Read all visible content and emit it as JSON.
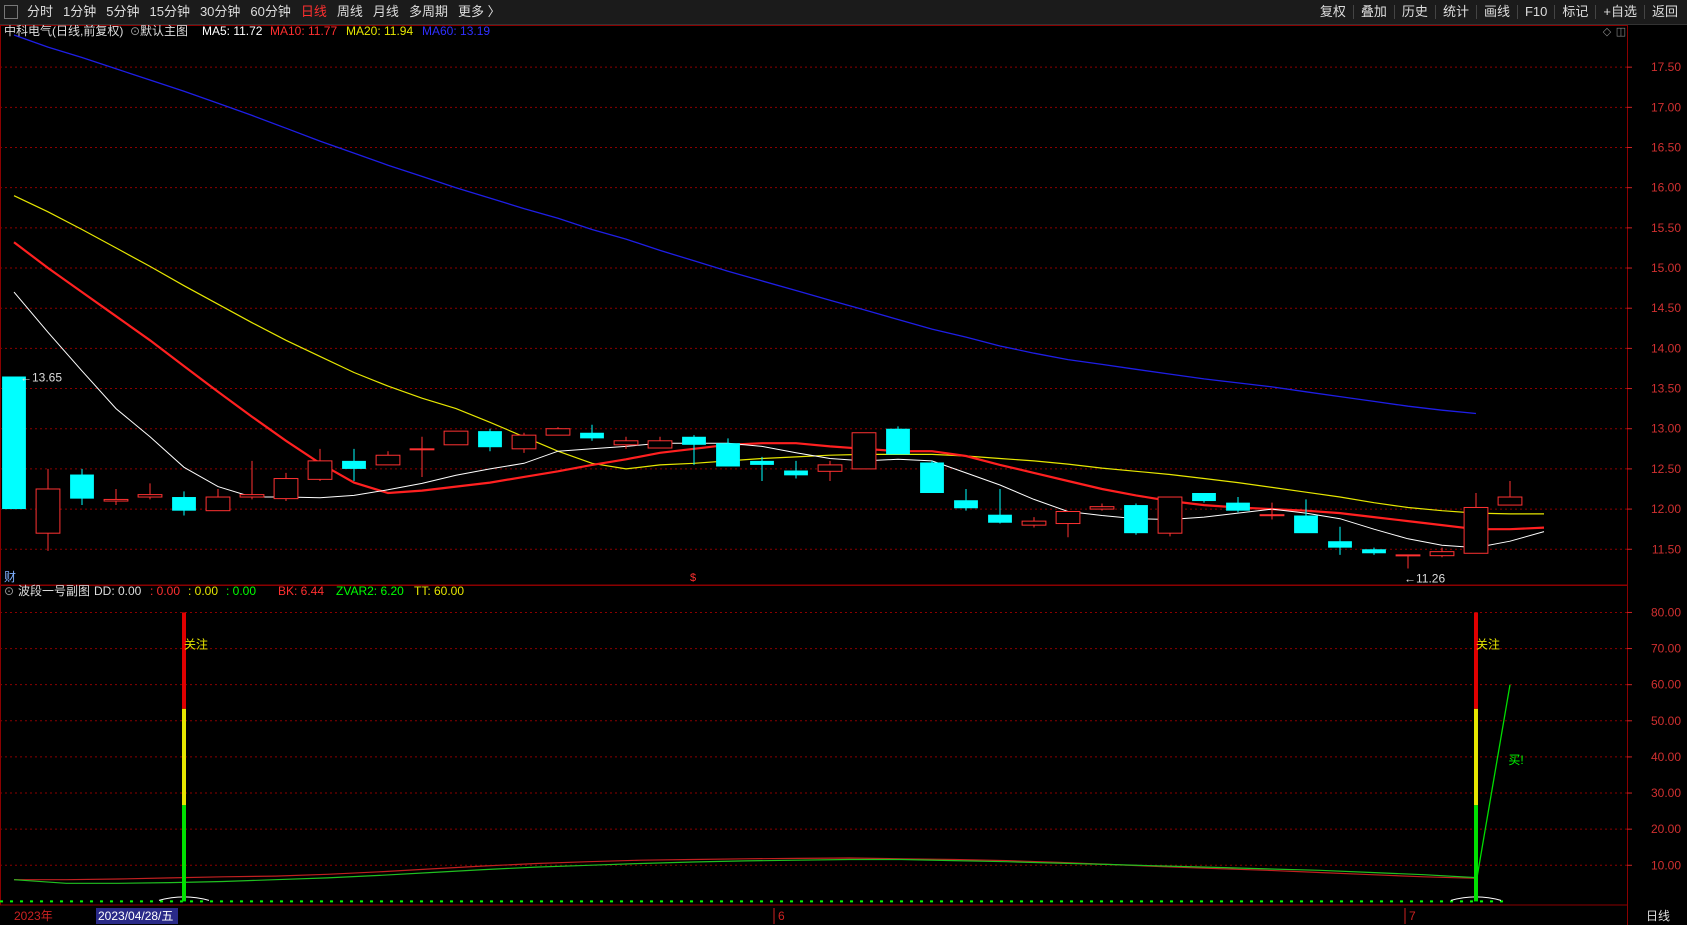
{
  "toolbar": {
    "periods": [
      "分时",
      "1分钟",
      "5分钟",
      "15分钟",
      "30分钟",
      "60分钟",
      "日线",
      "周线",
      "月线",
      "多周期",
      "更多 〉"
    ],
    "active_period": "日线",
    "right_buttons": [
      "复权",
      "叠加",
      "历史",
      "统计",
      "画线",
      "F10",
      "标记",
      "+自选",
      "返回"
    ]
  },
  "main_header": {
    "stock": "中科电气(日线,前复权)",
    "template": "默认主图",
    "ma5": "MA5: 11.72",
    "ma10": "MA10: 11.77",
    "ma20": "MA20: 11.94",
    "ma60": "MA60: 13.19"
  },
  "sub_header": {
    "name": "波段一号副图",
    "dd": "DD: 0.00",
    "v1": ": 0.00",
    "v2": ": 0.00",
    "v3": ": 0.00",
    "bk": "BK: 6.44",
    "zvar2": "ZVAR2: 6.20",
    "tt": "TT: 60.00"
  },
  "markers": {
    "cai": "财",
    "s": "$",
    "high_label": "13.65",
    "low_label": "11.26",
    "guanzhu": "关注",
    "buy": "买!",
    "period_label": "日线"
  },
  "colors": {
    "up": "#ff3232",
    "down": "#00ffff",
    "ma5": "#ffffff",
    "ma10": "#ff2020",
    "ma20": "#e6e600",
    "ma60": "#1e1ee6",
    "grid": "#8b0000"
  },
  "chart_data": [
    {
      "type": "candlestick",
      "title": "中科电气(日线,前复权)",
      "y_ticks": [
        17.5,
        17.0,
        16.5,
        16.0,
        15.5,
        15.0,
        14.5,
        14.0,
        13.5,
        13.0,
        12.5,
        12.0,
        11.5
      ],
      "ylim": [
        11.08,
        17.95
      ],
      "candles": [
        {
          "o": 13.65,
          "h": 13.65,
          "l": 12.0,
          "c": 12.0
        },
        {
          "o": 11.7,
          "h": 12.5,
          "l": 11.48,
          "c": 12.25
        },
        {
          "o": 12.43,
          "h": 12.5,
          "l": 12.05,
          "c": 12.13
        },
        {
          "o": 12.1,
          "h": 12.25,
          "l": 12.05,
          "c": 12.12
        },
        {
          "o": 12.15,
          "h": 12.32,
          "l": 12.12,
          "c": 12.18
        },
        {
          "o": 12.15,
          "h": 12.22,
          "l": 11.92,
          "c": 11.98
        },
        {
          "o": 11.98,
          "h": 12.25,
          "l": 11.98,
          "c": 12.15
        },
        {
          "o": 12.15,
          "h": 12.6,
          "l": 12.12,
          "c": 12.18
        },
        {
          "o": 12.13,
          "h": 12.45,
          "l": 12.1,
          "c": 12.38
        },
        {
          "o": 12.37,
          "h": 12.75,
          "l": 12.35,
          "c": 12.6
        },
        {
          "o": 12.6,
          "h": 12.75,
          "l": 12.35,
          "c": 12.5
        },
        {
          "o": 12.55,
          "h": 12.72,
          "l": 12.55,
          "c": 12.67
        },
        {
          "o": 12.75,
          "h": 12.9,
          "l": 12.4,
          "c": 12.75
        },
        {
          "o": 12.8,
          "h": 12.97,
          "l": 12.8,
          "c": 12.97
        },
        {
          "o": 12.97,
          "h": 13.0,
          "l": 12.72,
          "c": 12.77
        },
        {
          "o": 12.75,
          "h": 12.95,
          "l": 12.7,
          "c": 12.92
        },
        {
          "o": 12.92,
          "h": 13.02,
          "l": 12.92,
          "c": 13.0
        },
        {
          "o": 12.95,
          "h": 13.05,
          "l": 12.85,
          "c": 12.88
        },
        {
          "o": 12.8,
          "h": 12.9,
          "l": 12.75,
          "c": 12.85
        },
        {
          "o": 12.76,
          "h": 12.9,
          "l": 12.76,
          "c": 12.85
        },
        {
          "o": 12.9,
          "h": 12.92,
          "l": 12.55,
          "c": 12.8
        },
        {
          "o": 12.82,
          "h": 12.88,
          "l": 12.53,
          "c": 12.53
        },
        {
          "o": 12.6,
          "h": 12.65,
          "l": 12.35,
          "c": 12.55
        },
        {
          "o": 12.48,
          "h": 12.6,
          "l": 12.38,
          "c": 12.42
        },
        {
          "o": 12.47,
          "h": 12.6,
          "l": 12.35,
          "c": 12.55
        },
        {
          "o": 12.5,
          "h": 12.95,
          "l": 12.5,
          "c": 12.95
        },
        {
          "o": 13.0,
          "h": 13.03,
          "l": 12.68,
          "c": 12.68
        },
        {
          "o": 12.58,
          "h": 12.6,
          "l": 12.2,
          "c": 12.2
        },
        {
          "o": 12.11,
          "h": 12.25,
          "l": 11.98,
          "c": 12.01
        },
        {
          "o": 11.93,
          "h": 12.25,
          "l": 11.82,
          "c": 11.83
        },
        {
          "o": 11.8,
          "h": 11.9,
          "l": 11.77,
          "c": 11.85
        },
        {
          "o": 11.82,
          "h": 11.97,
          "l": 11.65,
          "c": 11.97
        },
        {
          "o": 12.0,
          "h": 12.07,
          "l": 11.98,
          "c": 12.03
        },
        {
          "o": 12.05,
          "h": 12.07,
          "l": 11.68,
          "c": 11.7
        },
        {
          "o": 11.7,
          "h": 12.15,
          "l": 11.66,
          "c": 12.15
        },
        {
          "o": 12.2,
          "h": 12.2,
          "l": 12.08,
          "c": 12.1
        },
        {
          "o": 12.08,
          "h": 12.15,
          "l": 11.96,
          "c": 11.98
        },
        {
          "o": 11.93,
          "h": 12.08,
          "l": 11.87,
          "c": 11.93
        },
        {
          "o": 11.92,
          "h": 12.12,
          "l": 11.78,
          "c": 11.7
        },
        {
          "o": 11.6,
          "h": 11.78,
          "l": 11.43,
          "c": 11.52
        },
        {
          "o": 11.5,
          "h": 11.52,
          "l": 11.43,
          "c": 11.45
        },
        {
          "o": 11.43,
          "h": 11.43,
          "l": 11.26,
          "c": 11.43
        },
        {
          "o": 11.42,
          "h": 11.52,
          "l": 11.4,
          "c": 11.47
        },
        {
          "o": 11.45,
          "h": 12.2,
          "l": 11.45,
          "c": 12.02
        },
        {
          "o": 12.05,
          "h": 12.35,
          "l": 12.05,
          "c": 12.15
        }
      ],
      "ma5": [
        14.7,
        14.2,
        13.72,
        13.25,
        12.9,
        12.52,
        12.28,
        12.15,
        12.15,
        12.14,
        12.17,
        12.24,
        12.32,
        12.42,
        12.5,
        12.57,
        12.72,
        12.75,
        12.78,
        12.82,
        12.82,
        12.82,
        12.78,
        12.7,
        12.63,
        12.6,
        12.62,
        12.6,
        12.45,
        12.3,
        12.12,
        11.97,
        11.92,
        11.88,
        11.87,
        11.9,
        11.95,
        12.0,
        11.95,
        11.88,
        11.75,
        11.63,
        11.55,
        11.52,
        11.6,
        11.72
      ],
      "ma10": [
        15.32,
        15.0,
        14.7,
        14.4,
        14.1,
        13.78,
        13.46,
        13.15,
        12.85,
        12.57,
        12.33,
        12.2,
        12.23,
        12.28,
        12.33,
        12.4,
        12.47,
        12.55,
        12.62,
        12.7,
        12.75,
        12.8,
        12.82,
        12.82,
        12.78,
        12.75,
        12.72,
        12.72,
        12.66,
        12.55,
        12.45,
        12.35,
        12.25,
        12.17,
        12.1,
        12.05,
        12.02,
        12.0,
        11.98,
        11.95,
        11.9,
        11.85,
        11.8,
        11.75,
        11.75,
        11.77
      ],
      "ma20": [
        15.9,
        15.7,
        15.48,
        15.25,
        15.02,
        14.78,
        14.55,
        14.32,
        14.1,
        13.9,
        13.7,
        13.53,
        13.38,
        13.25,
        13.08,
        12.9,
        12.72,
        12.57,
        12.5,
        12.55,
        12.57,
        12.6,
        12.63,
        12.65,
        12.67,
        12.68,
        12.68,
        12.68,
        12.66,
        12.63,
        12.6,
        12.56,
        12.51,
        12.47,
        12.43,
        12.38,
        12.33,
        12.27,
        12.21,
        12.15,
        12.08,
        12.02,
        11.98,
        11.95,
        11.94,
        11.94
      ],
      "ma60": [
        17.9,
        17.75,
        17.62,
        17.48,
        17.34,
        17.2,
        17.05,
        16.9,
        16.74,
        16.58,
        16.43,
        16.28,
        16.14,
        16.0,
        15.87,
        15.74,
        15.62,
        15.48,
        15.36,
        15.22,
        15.09,
        14.96,
        14.84,
        14.72,
        14.6,
        14.48,
        14.36,
        14.24,
        14.14,
        14.03,
        13.94,
        13.86,
        13.8,
        13.74,
        13.68,
        13.62,
        13.57,
        13.52,
        13.46,
        13.4,
        13.34,
        13.28,
        13.23,
        13.19
      ],
      "high_point": 13.65,
      "low_point": 11.26
    },
    {
      "type": "line",
      "title": "波段一号副图",
      "y_ticks": [
        80.0,
        70.0,
        60.0,
        50.0,
        40.0,
        30.0,
        20.0,
        10.0
      ],
      "ylim": [
        -1,
        84
      ],
      "spikes": [
        {
          "index": 5,
          "value": 80
        },
        {
          "index": 43,
          "value": 80
        }
      ],
      "bk": [
        6.0,
        6.0,
        6.2,
        6.5,
        6.8,
        7.0,
        7.5,
        8.2,
        9.0,
        9.8,
        10.5,
        11.0,
        11.4,
        11.6,
        11.8,
        11.9,
        12.0,
        11.8,
        11.6,
        11.3,
        10.8,
        10.2,
        9.6,
        9.1,
        8.6,
        8.0,
        7.4,
        6.8,
        6.4
      ],
      "zvar2": [
        6.0,
        5.0,
        5.0,
        5.2,
        5.5,
        6.0,
        6.5,
        7.2,
        8.0,
        8.8,
        9.5,
        10.0,
        10.5,
        10.9,
        11.2,
        11.4,
        11.6,
        11.6,
        11.3,
        11.0,
        10.6,
        10.2,
        9.8,
        9.4,
        9.0,
        8.6,
        8.0,
        7.4,
        6.6
      ],
      "tt_points": [
        {
          "index": 43,
          "value": 5
        },
        {
          "index": 44,
          "value": 60
        }
      ],
      "x_labels": [
        "2023年",
        "2023/04/28/五",
        "6",
        "7"
      ]
    }
  ]
}
